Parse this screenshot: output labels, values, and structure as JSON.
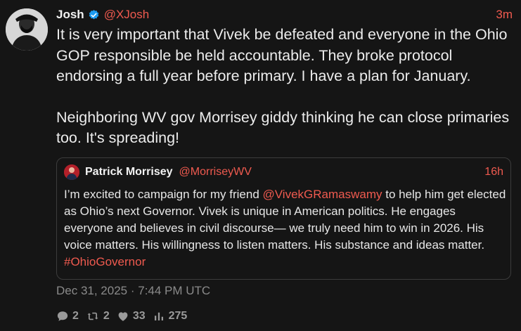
{
  "tweet": {
    "author": {
      "name": "Josh",
      "handle": "@XJosh",
      "verified": true,
      "avatar_icon": "masked-portrait-avatar"
    },
    "time_ago": "3m",
    "paragraphs": [
      "It is very important that Vivek be defeated and everyone in the Ohio GOP responsible be held accountable. They broke protocol endorsing a full year before primary. I have a plan for January.",
      "Neighboring WV gov Morrisey giddy thinking he can close primaries too. It's spreading!"
    ],
    "timestamp": "Dec 31, 2025 · 7:44 PM UTC",
    "stats": {
      "replies": "2",
      "retweets": "2",
      "likes": "33",
      "views": "275"
    }
  },
  "quoted_tweet": {
    "author": {
      "name": "Patrick Morrisey",
      "handle": "@MorriseyWV",
      "avatar_icon": "portrait-avatar"
    },
    "time_ago": "16h",
    "text_before_mention": "I’m excited to campaign for my friend ",
    "mention": "@VivekGRamaswamy",
    "text_after_mention": " to help him get elected as Ohio’s next Governor.  Vivek is unique in American politics.  He engages everyone and believes in civil discourse— we truly need him to win in 2026.  His voice matters.  His willingness to listen matters.  His substance and ideas matter. ",
    "hashtag": "#OhioGovernor"
  },
  "colors": {
    "background": "#151515",
    "accent": "#ef5a4f",
    "verified": "#1d9bf0",
    "muted": "#8a8a8a",
    "border": "#3c3c3c"
  },
  "icons": {
    "verified": "verified-badge-icon",
    "reply": "reply-bubble-icon",
    "retweet": "retweet-icon",
    "like": "heart-icon",
    "views": "bar-chart-icon"
  }
}
